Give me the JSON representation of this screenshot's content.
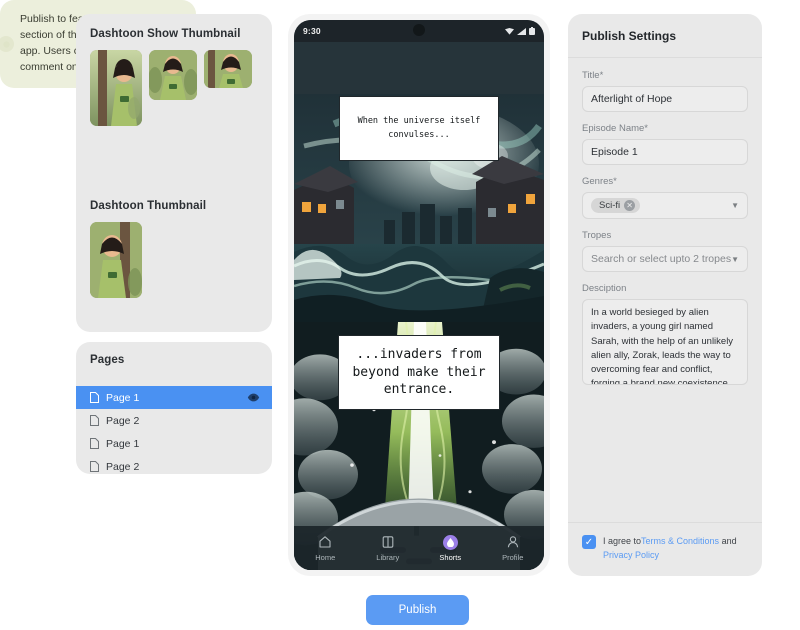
{
  "left": {
    "show_thumbnail_title": "Dashtoon Show Thumbnail",
    "thumbnail_title": "Dashtoon Thumbnail",
    "pages_title": "Pages",
    "pages": [
      {
        "label": "Page 1",
        "selected": true
      },
      {
        "label": "Page 2",
        "selected": false
      },
      {
        "label": "Page 1",
        "selected": false
      },
      {
        "label": "Page 2",
        "selected": false
      }
    ],
    "info_note": "Publish to feature in the ‘Shorts’ section of the Dashtoon mobile app. Users can read, like, and comment on your Dashtoon."
  },
  "phone": {
    "status_time": "9:30",
    "caption_1": "When the universe itself convulses...",
    "caption_2": "...invaders from beyond make their entrance.",
    "nav": [
      {
        "label": "Home",
        "icon": "home-icon",
        "active": false
      },
      {
        "label": "Library",
        "icon": "book-icon",
        "active": false
      },
      {
        "label": "Shorts",
        "icon": "shorts-icon",
        "active": true
      },
      {
        "label": "Profile",
        "icon": "person-icon",
        "active": false
      }
    ]
  },
  "settings": {
    "header": "Publish Settings",
    "title_label": "Title*",
    "title_value": "Afterlight of Hope",
    "episode_label": "Episode Name*",
    "episode_value": "Episode 1",
    "genres_label": "Genres*",
    "genre_chip": "Sci-fi",
    "tropes_label": "Tropes",
    "tropes_placeholder": "Search or select upto 2 tropes",
    "description_label": "Desciption",
    "description_value": "In a world besieged by alien invaders, a young girl named Sarah, with the help of an unlikely alien ally, Zorak, leads the way to overcoming fear and conflict, forging a brand new coexistence between humans",
    "terms_prefix": "I agree to",
    "terms_link": "Terms & Conditions",
    "terms_and": " and ",
    "privacy_link": "Privacy Policy"
  },
  "publish_button": "Publish",
  "colors": {
    "accent_blue": "#5b9bf3",
    "selected_blue": "#4a91f2",
    "panel_gray": "#e9e9e9",
    "note_green": "#ecefdc",
    "shorts_purple": "#9b7fe8"
  }
}
